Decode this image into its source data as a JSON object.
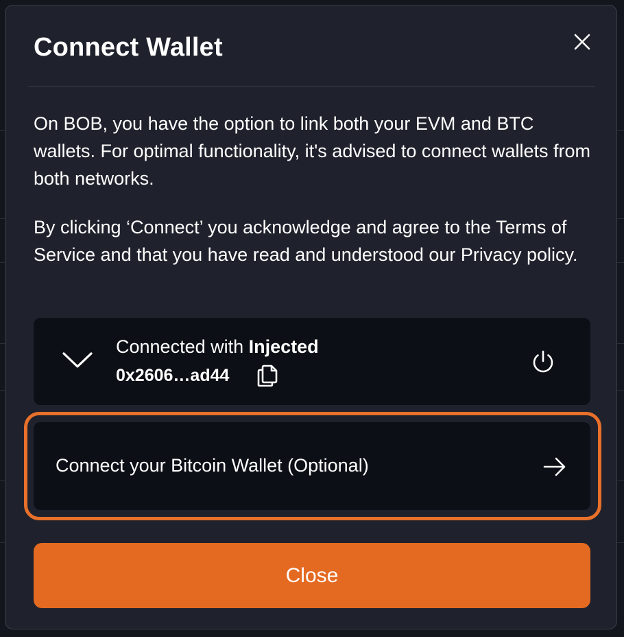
{
  "modal": {
    "title": "Connect Wallet",
    "close_icon": "close-icon",
    "paragraph_1": "On BOB, you have the option to link both your EVM and BTC wallets. For optimal functionality, it's advised to connect wallets from both networks.",
    "paragraph_2": "By clicking ‘Connect’ you acknowledge and agree to the Terms of Service and that you have read and understood our Privacy policy."
  },
  "evm_wallet": {
    "connected_prefix": "Connected with ",
    "connector_name": "Injected",
    "address": "0x2606…ad44",
    "expand_icon": "chevron-down-icon",
    "copy_icon": "copy-icon",
    "disconnect_icon": "power-icon"
  },
  "btc_wallet": {
    "label": "Connect your Bitcoin Wallet (Optional)",
    "arrow_icon": "arrow-right-icon"
  },
  "footer": {
    "close_label": "Close"
  },
  "colors": {
    "modal_bg": "#1f222c",
    "card_bg": "#0d0f16",
    "accent": "#e46a22",
    "highlight_outline": "#e8702a",
    "text": "#ffffff"
  }
}
